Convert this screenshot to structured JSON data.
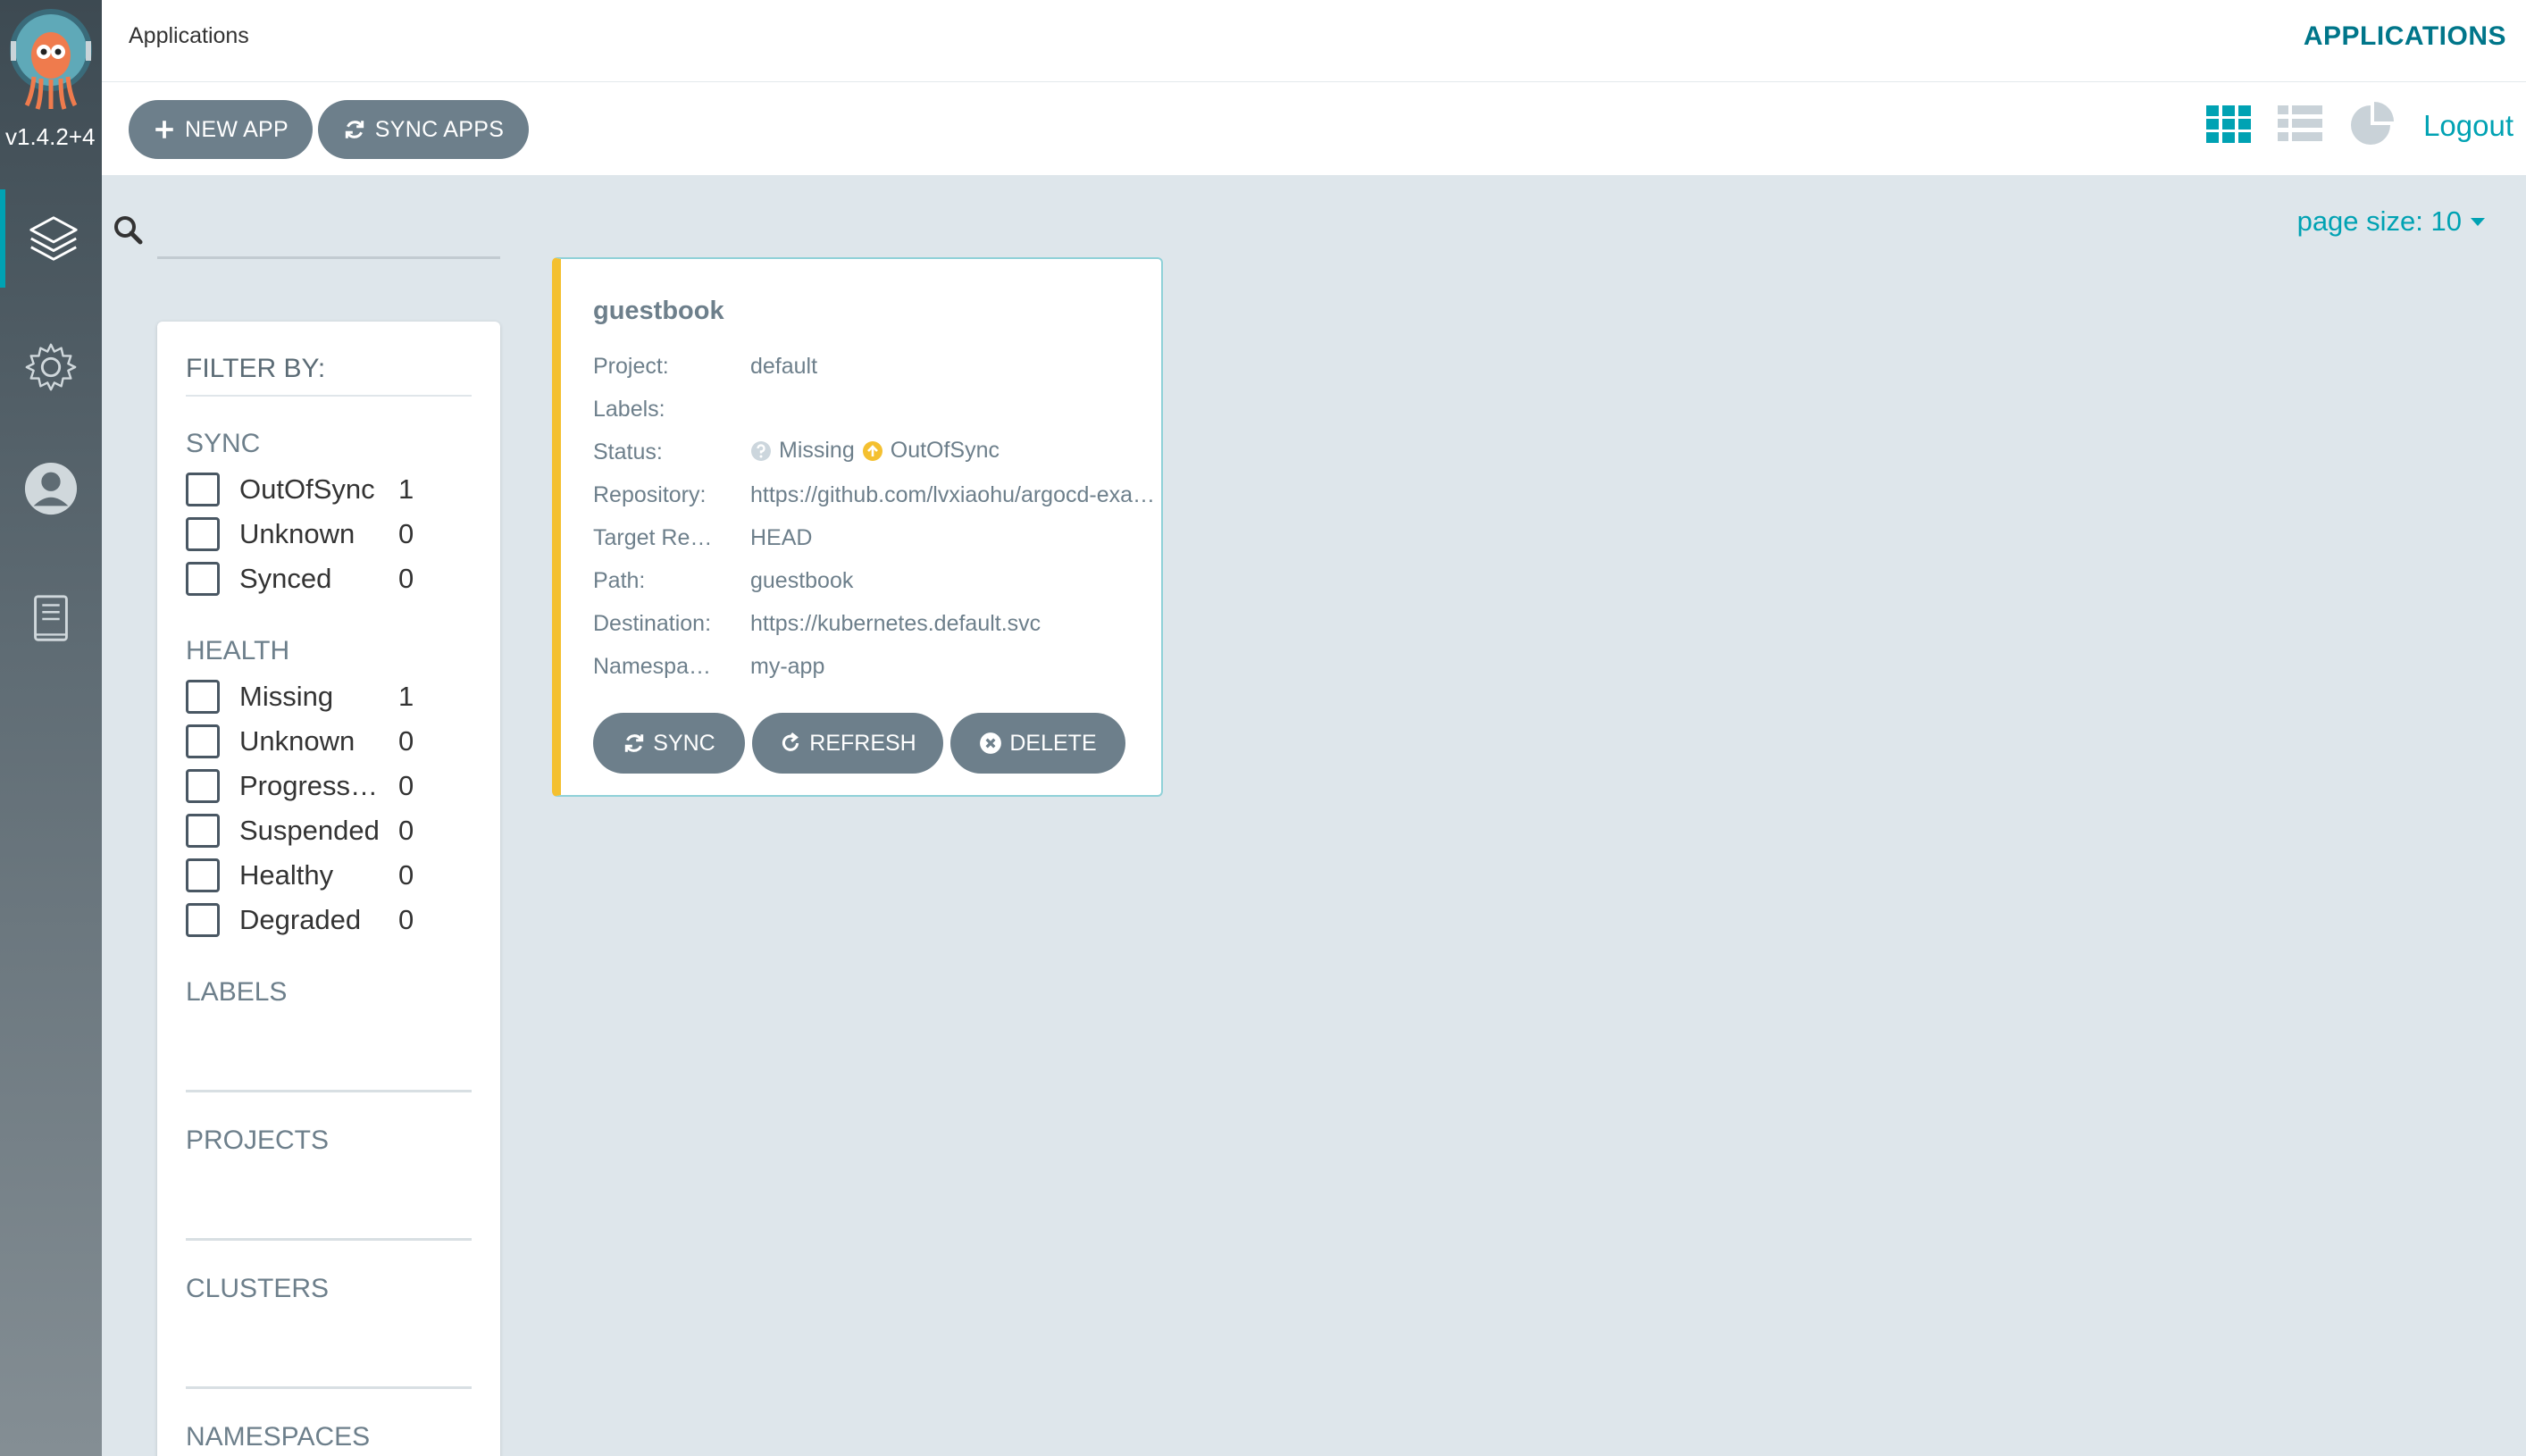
{
  "sidebar": {
    "version": "v1.4.2+4",
    "items": [
      {
        "name": "applications",
        "icon": "layers-icon",
        "active": true
      },
      {
        "name": "settings",
        "icon": "gear-icon",
        "active": false
      },
      {
        "name": "user-info",
        "icon": "user-icon",
        "active": false
      },
      {
        "name": "docs",
        "icon": "book-icon",
        "active": false
      }
    ]
  },
  "header": {
    "breadcrumb": "Applications",
    "title": "APPLICATIONS"
  },
  "toolbar": {
    "new_app_label": "NEW APP",
    "sync_apps_label": "SYNC APPS",
    "logout_label": "Logout"
  },
  "search": {
    "value": "",
    "placeholder": ""
  },
  "page_size": {
    "label": "page size: 10"
  },
  "filters": {
    "title": "FILTER BY:",
    "sync": {
      "title": "SYNC",
      "items": [
        {
          "label": "OutOfSync",
          "count": "1"
        },
        {
          "label": "Unknown",
          "count": "0"
        },
        {
          "label": "Synced",
          "count": "0"
        }
      ]
    },
    "health": {
      "title": "HEALTH",
      "items": [
        {
          "label": "Missing",
          "count": "1"
        },
        {
          "label": "Unknown",
          "count": "0"
        },
        {
          "label": "Progressing",
          "count": "0"
        },
        {
          "label": "Suspended",
          "count": "0"
        },
        {
          "label": "Healthy",
          "count": "0"
        },
        {
          "label": "Degraded",
          "count": "0"
        }
      ]
    },
    "labels_title": "LABELS",
    "projects_title": "PROJECTS",
    "clusters_title": "CLUSTERS",
    "namespaces_title": "NAMESPACES"
  },
  "app_card": {
    "name": "guestbook",
    "fields": {
      "project_label": "Project:",
      "project_value": "default",
      "labels_label": "Labels:",
      "labels_value": "",
      "status_label": "Status:",
      "health_status": "Missing",
      "sync_status": "OutOfSync",
      "repo_label": "Repository:",
      "repo_value": "https://github.com/lvxiaohu/argocd-example-apps",
      "target_label": "Target Revision:",
      "target_value": "HEAD",
      "path_label": "Path:",
      "path_value": "guestbook",
      "destination_label": "Destination:",
      "destination_value": "https://kubernetes.default.svc",
      "namespace_label": "Namespace:",
      "namespace_value": "my-app"
    },
    "buttons": {
      "sync": "SYNC",
      "refresh": "REFRESH",
      "delete": "DELETE"
    }
  },
  "colors": {
    "accent": "#00a2b3",
    "title": "#00768a",
    "button": "#6d7f8b",
    "out_of_sync": "#f4c030",
    "missing": "#ccd6dd"
  }
}
